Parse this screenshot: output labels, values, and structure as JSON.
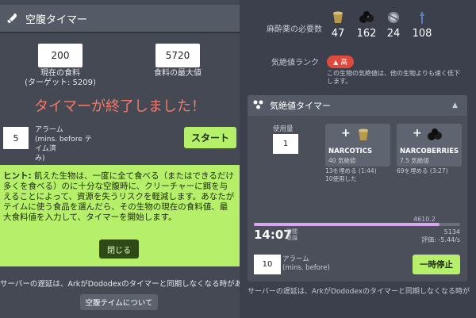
{
  "left": {
    "header_title": "空腹タイマー",
    "current_food": {
      "value": "200",
      "label": "現在の食料",
      "target": "(ターゲット: 5209)"
    },
    "max_food": {
      "value": "5720",
      "label": "食料の最大値"
    },
    "finished_text": "タイマーが終了しました！",
    "alarm": {
      "value": "5",
      "label1": "アラーム",
      "label2": "(mins. before テイム済",
      "label3": "み)"
    },
    "start_label": "スタート",
    "hint_bold": "ヒント:",
    "hint_text": " 飢えた生物は、一度に全て食べる（またはできるだけ多くを食べる）のに十分な空腹時に、クリーチャーに餌を与えることによって、資源を失うリスクを軽減します。あなたがテイムに使う食品を選んだら、その生物の現在の食料値、最大食料値を入力して、タイマーを開始します。",
    "close_label": "閉じる",
    "note": "サーバーの遅延は、ArkがDododexのタイマーと同期しなくなる時があります。",
    "about_label": "空腹テイムについて"
  },
  "right": {
    "required_label": "麻酔薬の必要数",
    "resources": [
      {
        "icon": "narcotics-icon",
        "value": "47"
      },
      {
        "icon": "narcoberries-icon",
        "value": "162"
      },
      {
        "icon": "bio-toxin-icon",
        "value": "24"
      },
      {
        "icon": "tranq-arrow-icon",
        "value": "108"
      }
    ],
    "torpor_rank_label": "気絶値ランク",
    "torpor_badge": "高",
    "torpor_note": "この生物の気絶値は、他の生物よりも速く低下します。",
    "torpor_timer_title": "気絶値タイマー",
    "qty_label": "使用量",
    "qty_value": "1",
    "foods": [
      {
        "icon": "narcotics-icon",
        "name": "NARCOTICS",
        "sub": "40 気絶値",
        "info1": "13を埋める (1:44)",
        "info2": "10使用した"
      },
      {
        "icon": "narcoberries-icon",
        "name": "NARCOBERRIES",
        "sub": "7.5 気絶値",
        "info1": "69を埋める (3:27)",
        "info2": ""
      }
    ],
    "bar_value": "4610.2",
    "bar_fill_fraction": 0.9,
    "clock": "14:07",
    "clock_sub1": "時間",
    "clock_sub2": "意識",
    "bar_max": "5134",
    "rate": "評価: -5.44/s",
    "alarm_value": "10",
    "alarm_label1": "アラーム",
    "alarm_label2": "(mins. before)",
    "pause_label": "一時停止",
    "note": "サーバーの遅延は、ArkがDododexのタイマーと同期しなくなる時があります。"
  },
  "colors": {
    "accent_green": "#b6f06a",
    "finished_red": "#f07a6b",
    "badge_red": "#e04a3c",
    "torpor_bar": "#d6a6ee"
  }
}
